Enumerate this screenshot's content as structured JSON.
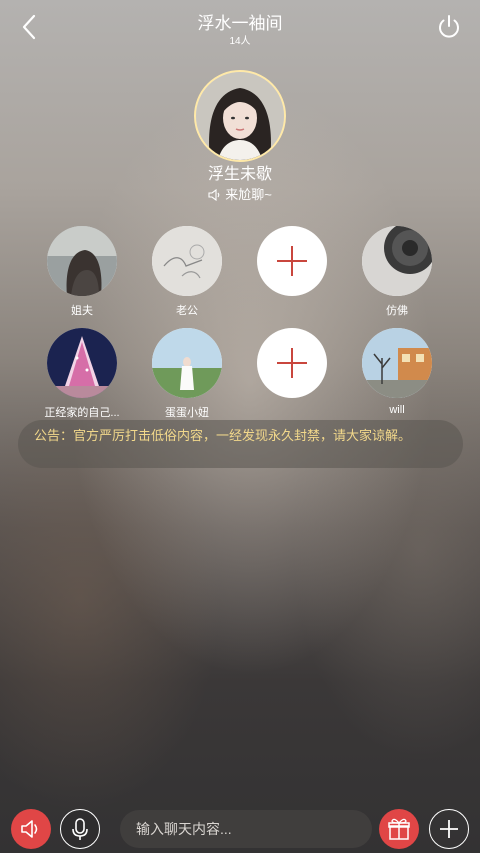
{
  "header": {
    "title": "浮水一袖间",
    "count": "14人",
    "back_icon": "chevron-left-icon",
    "power_icon": "power-icon"
  },
  "host": {
    "name": "浮生未歇",
    "status": "来尬聊~",
    "status_icon": "speaker-icon"
  },
  "seats": [
    {
      "label": "姐夫",
      "occupied": true
    },
    {
      "label": "老公",
      "occupied": true
    },
    {
      "label": "",
      "occupied": false
    },
    {
      "label": "仿佛",
      "occupied": true
    },
    {
      "label": "正经家的自己...",
      "occupied": true
    },
    {
      "label": "蛋蛋小妞",
      "occupied": true
    },
    {
      "label": "",
      "occupied": false
    },
    {
      "label": "will",
      "occupied": true
    }
  ],
  "notice": {
    "text": "公告：官方严厉打击低俗内容，一经发现永久封禁，请大家谅解。"
  },
  "bottom_bar": {
    "input_placeholder": "输入聊天内容...",
    "accent": "#e04646"
  },
  "colors": {
    "notice_text": "#f2d88b",
    "seat_plus": "#c9463d"
  }
}
